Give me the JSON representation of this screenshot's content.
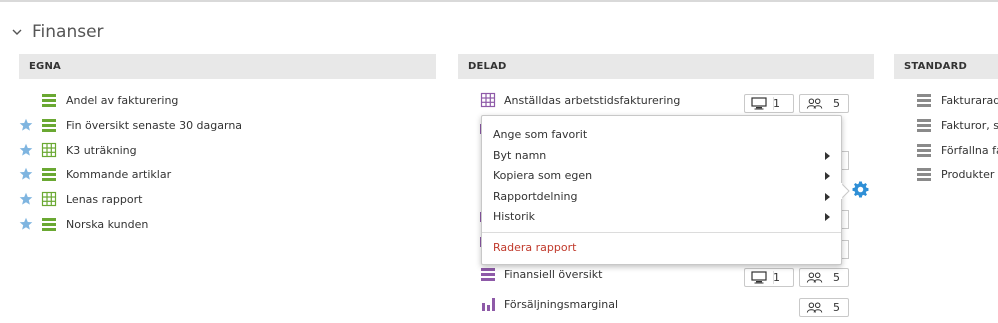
{
  "section": {
    "title": "Finanser"
  },
  "columns": {
    "egna": {
      "label": "EGNA",
      "items": [
        {
          "label": "Andel av fakturering",
          "favorite": false,
          "icon": "bars-green"
        },
        {
          "label": "Fin översikt senaste 30 dagarna",
          "favorite": true,
          "icon": "bars-green"
        },
        {
          "label": "K3 uträkning",
          "favorite": true,
          "icon": "grid-green"
        },
        {
          "label": "Kommande artiklar",
          "favorite": true,
          "icon": "bars-green"
        },
        {
          "label": "Lenas rapport",
          "favorite": true,
          "icon": "grid-green"
        },
        {
          "label": "Norska kunden",
          "favorite": true,
          "icon": "bars-green"
        }
      ]
    },
    "delad": {
      "label": "DELAD",
      "items": [
        {
          "label": "Anställdas arbetstidsfakturering",
          "icon": "grid-purple",
          "screens": "1",
          "users": "5"
        },
        {
          "label": "Finansiell översikt",
          "icon": "bars-purple",
          "screens": "1",
          "users": "5"
        },
        {
          "label": "Försäljningsmarginal",
          "icon": "chart-purple",
          "users": "5"
        }
      ]
    },
    "standard": {
      "label": "STANDARD",
      "items": [
        {
          "label": "Fakturarade",
          "icon": "bars-gray"
        },
        {
          "label": "Fakturor, se",
          "icon": "bars-gray"
        },
        {
          "label": "Förfallna fa",
          "icon": "bars-gray"
        },
        {
          "label": "Produkter",
          "icon": "bars-gray"
        }
      ]
    }
  },
  "context_menu": {
    "items": [
      {
        "label": "Ange som favorit",
        "submenu": false
      },
      {
        "label": "Byt namn",
        "submenu": true
      },
      {
        "label": "Kopiera som egen",
        "submenu": true
      },
      {
        "label": "Rapportdelning",
        "submenu": true
      },
      {
        "label": "Historik",
        "submenu": true
      }
    ],
    "delete_label": "Radera rapport"
  },
  "colors": {
    "green": "#6aa832",
    "purple": "#8e5aa8",
    "gray": "#8a8a8a",
    "star": "#7fb5e0",
    "gear": "#2f8fd6",
    "danger": "#c0392b"
  }
}
